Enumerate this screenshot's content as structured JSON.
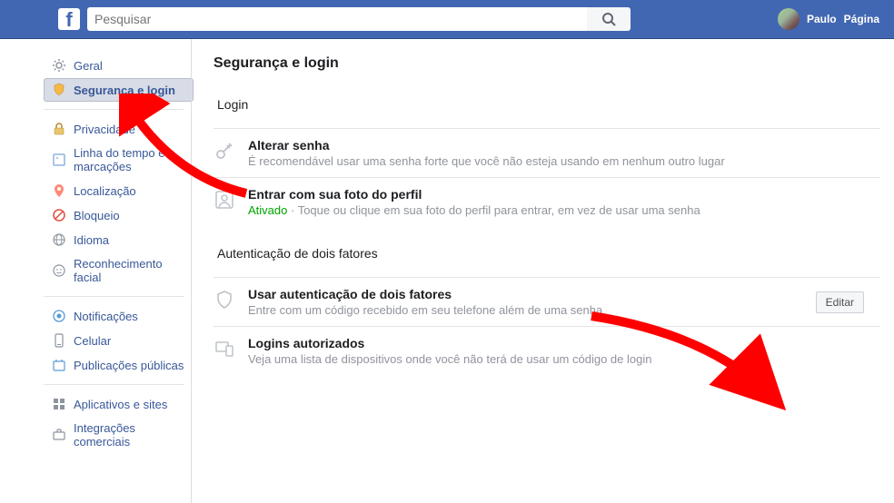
{
  "header": {
    "search_placeholder": "Pesquisar",
    "user_name": "Paulo",
    "page_link": "Página"
  },
  "sidebar": {
    "items": [
      {
        "label": "Geral",
        "icon": "gear"
      },
      {
        "label": "Segurança e login",
        "icon": "shield",
        "active": true
      },
      {
        "label": "Privacidade",
        "icon": "lock"
      },
      {
        "label": "Linha do tempo e marcações",
        "icon": "tag"
      },
      {
        "label": "Localização",
        "icon": "location"
      },
      {
        "label": "Bloqueio",
        "icon": "block"
      },
      {
        "label": "Idioma",
        "icon": "globe"
      },
      {
        "label": "Reconhecimento facial",
        "icon": "face"
      },
      {
        "label": "Notificações",
        "icon": "bell"
      },
      {
        "label": "Celular",
        "icon": "mobile"
      },
      {
        "label": "Publicações públicas",
        "icon": "public"
      },
      {
        "label": "Aplicativos e sites",
        "icon": "apps"
      },
      {
        "label": "Integrações comerciais",
        "icon": "biz"
      }
    ]
  },
  "main": {
    "title": "Segurança e login",
    "sections": [
      {
        "header": "Login",
        "rows": [
          {
            "icon": "key",
            "title": "Alterar senha",
            "desc": "É recomendável usar uma senha forte que você não esteja usando em nenhum outro lugar"
          },
          {
            "icon": "profile-pic",
            "title": "Entrar com sua foto do perfil",
            "status": "Ativado",
            "desc_sep": " · ",
            "desc": "Toque ou clique em sua foto do perfil para entrar, em vez de usar uma senha"
          }
        ]
      },
      {
        "header": "Autenticação de dois fatores",
        "rows": [
          {
            "icon": "shield-outline",
            "title": "Usar autenticação de dois fatores",
            "desc": "Entre com um código recebido em seu telefone além de uma senha",
            "action": "Editar"
          },
          {
            "icon": "devices",
            "title": "Logins autorizados",
            "desc": "Veja uma lista de dispositivos onde você não terá de usar um código de login"
          }
        ]
      }
    ]
  }
}
